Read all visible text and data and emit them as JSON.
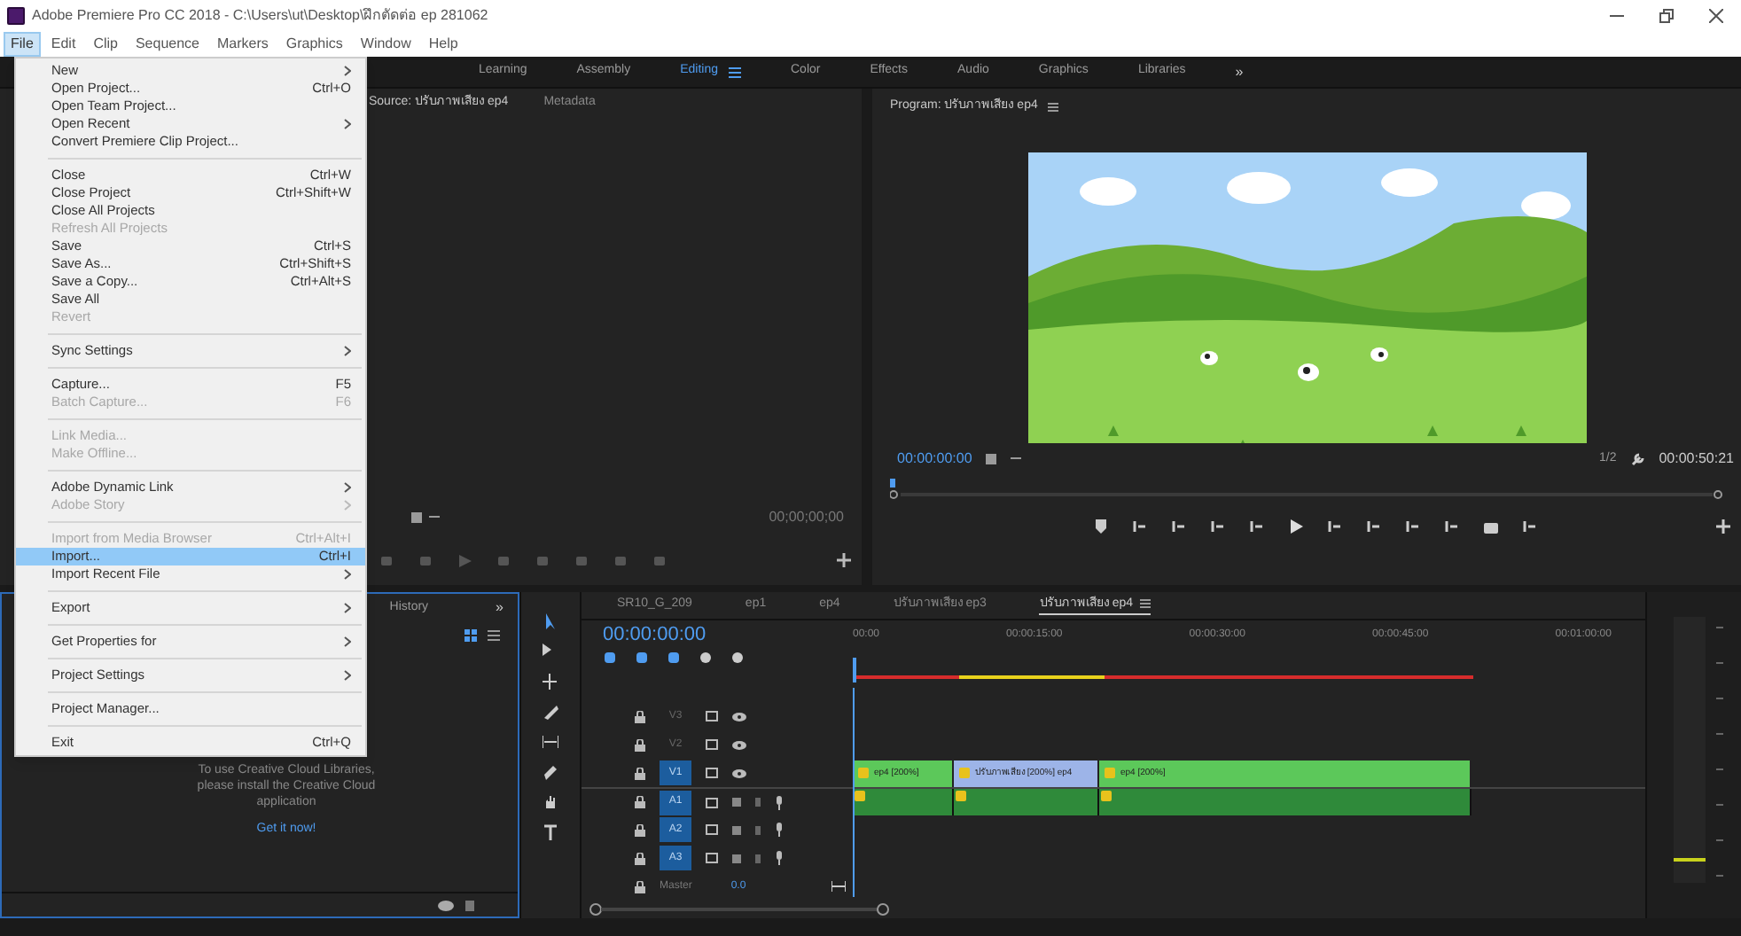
{
  "window": {
    "title": "Adobe Premiere Pro CC 2018 - C:\\Users\\ut\\Desktop\\ฝึกตัดต่อ ep 281062"
  },
  "menu_bar": [
    {
      "label": "File",
      "selected": true
    },
    {
      "label": "Edit",
      "selected": false
    },
    {
      "label": "Clip",
      "selected": false
    },
    {
      "label": "Sequence",
      "selected": false
    },
    {
      "label": "Markers",
      "selected": false
    },
    {
      "label": "Graphics",
      "selected": false
    },
    {
      "label": "Window",
      "selected": false
    },
    {
      "label": "Help",
      "selected": false
    }
  ],
  "file_menu": [
    {
      "kind": "item",
      "label": "New",
      "submenu": true,
      "disabled": false,
      "selected": false
    },
    {
      "kind": "item",
      "label": "Open Project...",
      "shortcut": "Ctrl+O",
      "submenu": false,
      "disabled": false,
      "selected": false
    },
    {
      "kind": "item",
      "label": "Open Team Project...",
      "submenu": false,
      "disabled": false,
      "selected": false
    },
    {
      "kind": "item",
      "label": "Open Recent",
      "submenu": true,
      "disabled": false,
      "selected": false
    },
    {
      "kind": "item",
      "label": "Convert Premiere Clip Project...",
      "submenu": false,
      "disabled": false,
      "selected": false
    },
    {
      "kind": "separator"
    },
    {
      "kind": "item",
      "label": "Close",
      "shortcut": "Ctrl+W",
      "submenu": false,
      "disabled": false,
      "selected": false
    },
    {
      "kind": "item",
      "label": "Close Project",
      "shortcut": "Ctrl+Shift+W",
      "submenu": false,
      "disabled": false,
      "selected": false
    },
    {
      "kind": "item",
      "label": "Close All Projects",
      "submenu": false,
      "disabled": false,
      "selected": false
    },
    {
      "kind": "item",
      "label": "Refresh All Projects",
      "submenu": false,
      "disabled": true,
      "selected": false
    },
    {
      "kind": "item",
      "label": "Save",
      "shortcut": "Ctrl+S",
      "submenu": false,
      "disabled": false,
      "selected": false
    },
    {
      "kind": "item",
      "label": "Save As...",
      "shortcut": "Ctrl+Shift+S",
      "submenu": false,
      "disabled": false,
      "selected": false
    },
    {
      "kind": "item",
      "label": "Save a Copy...",
      "shortcut": "Ctrl+Alt+S",
      "submenu": false,
      "disabled": false,
      "selected": false
    },
    {
      "kind": "item",
      "label": "Save All",
      "submenu": false,
      "disabled": false,
      "selected": false
    },
    {
      "kind": "item",
      "label": "Revert",
      "submenu": false,
      "disabled": true,
      "selected": false
    },
    {
      "kind": "separator"
    },
    {
      "kind": "item",
      "label": "Sync Settings",
      "submenu": true,
      "disabled": false,
      "selected": false
    },
    {
      "kind": "separator"
    },
    {
      "kind": "item",
      "label": "Capture...",
      "shortcut": "F5",
      "submenu": false,
      "disabled": false,
      "selected": false
    },
    {
      "kind": "item",
      "label": "Batch Capture...",
      "shortcut": "F6",
      "submenu": false,
      "disabled": true,
      "selected": false
    },
    {
      "kind": "separator"
    },
    {
      "kind": "item",
      "label": "Link Media...",
      "submenu": false,
      "disabled": true,
      "selected": false
    },
    {
      "kind": "item",
      "label": "Make Offline...",
      "submenu": false,
      "disabled": true,
      "selected": false
    },
    {
      "kind": "separator"
    },
    {
      "kind": "item",
      "label": "Adobe Dynamic Link",
      "submenu": true,
      "disabled": false,
      "selected": false
    },
    {
      "kind": "item",
      "label": "Adobe Story",
      "submenu": true,
      "disabled": true,
      "selected": false
    },
    {
      "kind": "separator"
    },
    {
      "kind": "item",
      "label": "Import from Media Browser",
      "shortcut": "Ctrl+Alt+I",
      "submenu": false,
      "disabled": true,
      "selected": false
    },
    {
      "kind": "item",
      "label": "Import...",
      "shortcut": "Ctrl+I",
      "submenu": false,
      "disabled": false,
      "selected": true
    },
    {
      "kind": "item",
      "label": "Import Recent File",
      "submenu": true,
      "disabled": false,
      "selected": false
    },
    {
      "kind": "separator"
    },
    {
      "kind": "item",
      "label": "Export",
      "submenu": true,
      "disabled": false,
      "selected": false
    },
    {
      "kind": "separator"
    },
    {
      "kind": "item",
      "label": "Get Properties for",
      "submenu": true,
      "disabled": false,
      "selected": false
    },
    {
      "kind": "separator"
    },
    {
      "kind": "item",
      "label": "Project Settings",
      "submenu": true,
      "disabled": false,
      "selected": false
    },
    {
      "kind": "separator"
    },
    {
      "kind": "item",
      "label": "Project Manager...",
      "submenu": false,
      "disabled": false,
      "selected": false
    },
    {
      "kind": "separator"
    },
    {
      "kind": "item",
      "label": "Exit",
      "shortcut": "Ctrl+Q",
      "submenu": false,
      "disabled": false,
      "selected": false
    }
  ],
  "workspaces": [
    {
      "label": "Learning",
      "selected": false
    },
    {
      "label": "Assembly",
      "selected": false
    },
    {
      "label": "Editing",
      "selected": true
    },
    {
      "label": "Color",
      "selected": false
    },
    {
      "label": "Effects",
      "selected": false
    },
    {
      "label": "Audio",
      "selected": false
    },
    {
      "label": "Graphics",
      "selected": false
    },
    {
      "label": "Libraries",
      "selected": false
    }
  ],
  "workspaces_more": "»",
  "source_panel": {
    "tabs": [
      {
        "label": "Source: ปรับภาพเสียง ep4",
        "selected": true
      },
      {
        "label": "Metadata",
        "selected": false
      }
    ],
    "timecode": "00;00;00;00"
  },
  "program_panel": {
    "title": "Program: ปรับภาพเสียง ep4",
    "current_time": "00:00:00:00",
    "resolution": "1/2",
    "duration": "00:00:50:21"
  },
  "libraries_panel": {
    "tab": "History",
    "more": "»",
    "message": "To use Creative Cloud Libraries, please install the Creative Cloud application",
    "link": "Get it now!"
  },
  "timeline": {
    "tabs": [
      {
        "label": "SR10_G_209",
        "selected": false
      },
      {
        "label": "ep1",
        "selected": false
      },
      {
        "label": "ep4",
        "selected": false
      },
      {
        "label": "ปรับภาพเสียง ep3",
        "selected": false
      },
      {
        "label": "ปรับภาพเสียง ep4",
        "selected": true
      }
    ],
    "timecode": "00:00:00:00",
    "ruler": [
      "00:00",
      "00:00:15:00",
      "00:00:30:00",
      "00:00:45:00",
      "00:01:00:00"
    ],
    "tracks": [
      {
        "kind": "video",
        "label": "V3",
        "targeted": false
      },
      {
        "kind": "video",
        "label": "V2",
        "targeted": false
      },
      {
        "kind": "video",
        "label": "V1",
        "targeted": true,
        "clips": [
          {
            "label": "ep4 [200%]",
            "color": "#5cc85a"
          },
          {
            "label": "ปรับภาพเสียง [200%] ep4",
            "color": "#9db4e8"
          },
          {
            "label": "ep4 [200%]",
            "color": "#5cc85a"
          }
        ]
      },
      {
        "kind": "audio",
        "label": "A1",
        "targeted": true,
        "clips": [
          {
            "fx": true
          },
          {
            "fx": true
          },
          {
            "fx": true
          }
        ]
      },
      {
        "kind": "audio",
        "label": "A2",
        "targeted": true
      },
      {
        "kind": "audio",
        "label": "A3",
        "targeted": true
      }
    ],
    "master": {
      "label": "Master",
      "value": "0.0"
    }
  }
}
